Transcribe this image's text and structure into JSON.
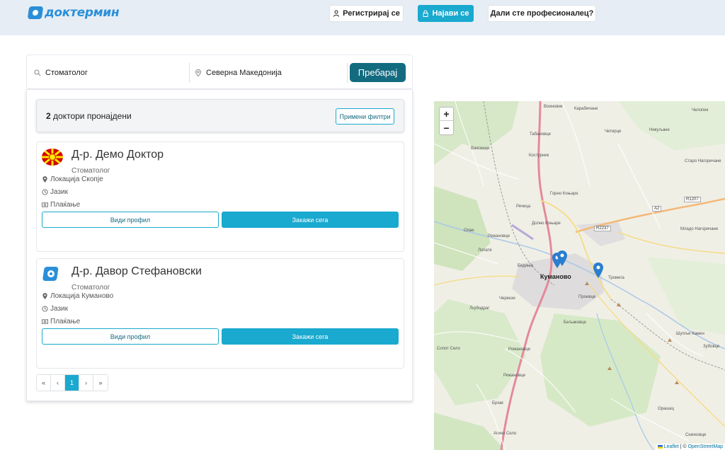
{
  "header": {
    "logo_text": "доктермин",
    "register_label": "Регистрирај се",
    "login_label": "Најави се",
    "professional_label": "Дали сте професионалец?"
  },
  "search": {
    "specialty_value": "Стоматолог",
    "location_value": "Северна Македонија",
    "search_button": "Пребарај"
  },
  "results": {
    "count": "2",
    "count_suffix": "доктори пронајдени",
    "filter_button": "Примени филтри",
    "doctors": [
      {
        "name": "Д-р. Демо Доктор",
        "specialty": "Стоматолог",
        "location": "Локација Скопје",
        "language": "Јазик",
        "payment": "Плаќање",
        "view_profile": "Види профил",
        "book_now": "Закажи сега",
        "avatar": "north-macedonia-flag"
      },
      {
        "name": "Д-р. Давор Стефановски",
        "specialty": "Стоматолог",
        "location": "Локација Куманово",
        "language": "Јазик",
        "payment": "Плаќање",
        "view_profile": "Види профил",
        "book_now": "Закажи сега",
        "avatar": "doktermin-logo"
      }
    ]
  },
  "pagination": {
    "first": "«",
    "prev": "‹",
    "current": "1",
    "next": "›",
    "last": "»"
  },
  "map": {
    "zoom_in": "+",
    "zoom_out": "−",
    "attribution_leaflet": "Leaflet",
    "attribution_sep": " | © ",
    "attribution_osm": "OpenStreetMap",
    "labels": {
      "voinovik": "Воиновик",
      "karabichane": "Карабичане",
      "chelopek": "Челопек",
      "tabanovce": "Табановце",
      "chetirce": "Четирце",
      "nikuljane": "Никуљане",
      "vaksince": "Ваксинце",
      "kosturnik": "Костурник",
      "staro_nagoricane": "Старо Нагоричане",
      "gorno_konjare": "Горно Коњаре",
      "rechica": "Речица",
      "dolno_konjare": "Долно Коњаре",
      "mlado_nagoricane": "Младо Нагоричане",
      "ogjaе": "Опае",
      "rezhanovce": "Режановце",
      "lopate": "Лопате",
      "bedinje": "Бедиње",
      "kumanovo": "Куманово",
      "tromega": "Тромега",
      "cherkezi": "Черкези",
      "proevce": "Проевце",
      "ljubodrag": "Љубодраг",
      "biljanovce": "Бељаковце",
      "shuplji_kamen": "Шупљи Камен",
      "zubovce": "Зубовце",
      "romanovce": "Романовце",
      "sopot_selo": "Сопот Село",
      "rezhanovce2": "Режановце",
      "orashac": "Орашац",
      "brzak": "Брзак",
      "agino_selo": "Агино Село",
      "skachkovce": "Скачковце",
      "r1207": "R1207",
      "a2": "A2",
      "r2237": "R2237"
    }
  },
  "colors": {
    "accent": "#1aa9cf",
    "dark_teal": "#136b80",
    "header_bg": "#e6edf5"
  }
}
